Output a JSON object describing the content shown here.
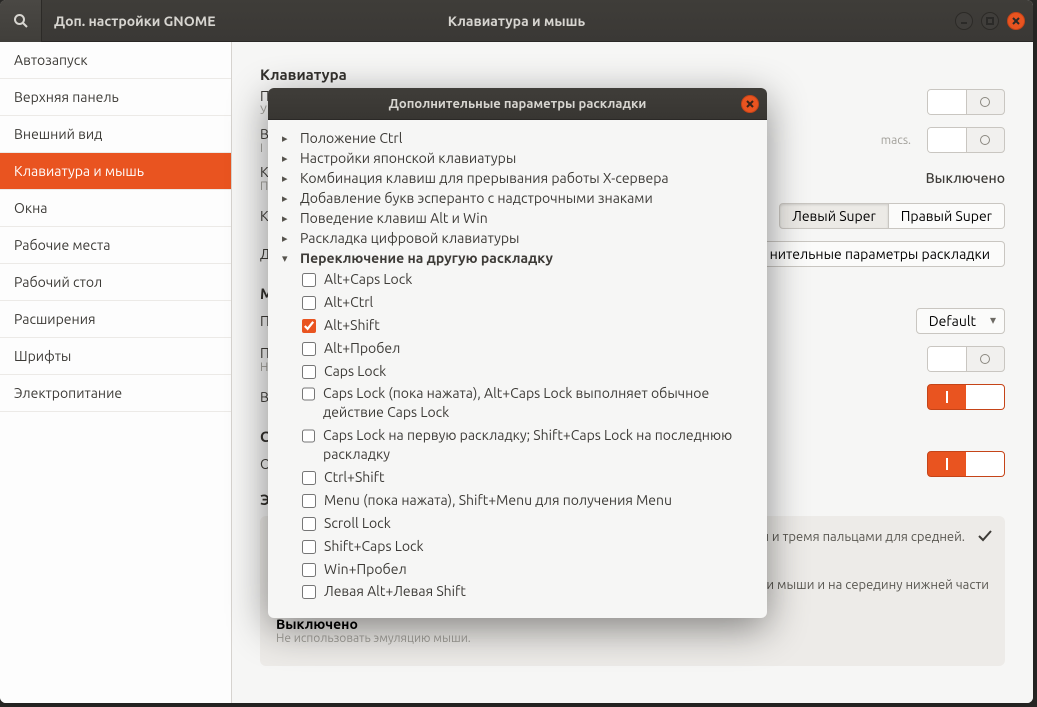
{
  "app": {
    "title": "Доп. настройки GNOME",
    "page_title": "Клавиатура и мышь"
  },
  "sidebar": {
    "items": [
      {
        "label": "Автозапуск"
      },
      {
        "label": "Верхняя панель"
      },
      {
        "label": "Внешний вид"
      },
      {
        "label": "Клавиатура и мышь",
        "active": true
      },
      {
        "label": "Окна"
      },
      {
        "label": "Рабочие места"
      },
      {
        "label": "Рабочий стол"
      },
      {
        "label": "Расширения"
      },
      {
        "label": "Шрифты"
      },
      {
        "label": "Электропитание"
      }
    ]
  },
  "main": {
    "keyboard_heading": "Клавиатура",
    "hint_macs": "macs.",
    "status_off": "Выключено",
    "overview_shortcut_label": "К",
    "super_left": "Левый Super",
    "super_right": "Правый Super",
    "extra_btn": "нительные параметры раскладки",
    "default": "Default",
    "box_text1": "мыши и тремя пальцами для средней.",
    "box_text2": "нопки мыши и на середину нижней части",
    "disabled_title": "Выключено",
    "disabled_sub": "Не использовать эмуляцию мыши."
  },
  "dialog": {
    "title": "Дополнительные параметры раскладки",
    "groups": [
      {
        "label": "Положение Ctrl",
        "expanded": false
      },
      {
        "label": "Настройки японской клавиатуры",
        "expanded": false
      },
      {
        "label": "Комбинация клавиш для прерывания работы X-сервера",
        "expanded": false
      },
      {
        "label": "Добавление букв эсперанто с надстрочными знаками",
        "expanded": false
      },
      {
        "label": "Поведение клавиш Alt и Win",
        "expanded": false
      },
      {
        "label": "Раскладка цифровой клавиатуры",
        "expanded": false
      },
      {
        "label": "Переключение на другую раскладку",
        "expanded": true
      }
    ],
    "options": [
      {
        "label": "Alt+Caps Lock",
        "checked": false
      },
      {
        "label": "Alt+Ctrl",
        "checked": false
      },
      {
        "label": "Alt+Shift",
        "checked": true
      },
      {
        "label": "Alt+Пробел",
        "checked": false
      },
      {
        "label": "Caps Lock",
        "checked": false
      },
      {
        "label": "Caps Lock (пока нажата), Alt+Caps Lock выполняет обычное действие Caps Lock",
        "checked": false
      },
      {
        "label": "Caps Lock на первую раскладку; Shift+Caps Lock на последнюю раскладку",
        "checked": false
      },
      {
        "label": "Ctrl+Shift",
        "checked": false
      },
      {
        "label": "Menu (пока нажата), Shift+Menu для получения Menu",
        "checked": false
      },
      {
        "label": "Scroll Lock",
        "checked": false
      },
      {
        "label": "Shift+Caps Lock",
        "checked": false
      },
      {
        "label": "Win+Пробел",
        "checked": false
      },
      {
        "label": "Левая Alt+Левая Shift",
        "checked": false
      }
    ]
  }
}
